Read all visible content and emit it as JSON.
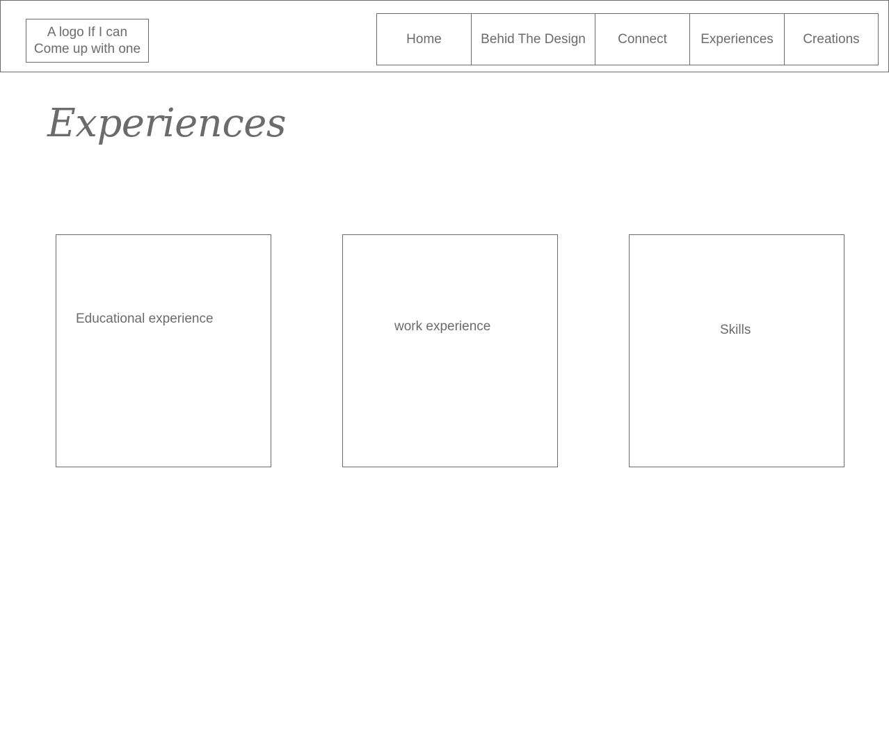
{
  "header": {
    "logo_text": "A logo If I can Come up with one",
    "nav": [
      {
        "label": "Home"
      },
      {
        "label": "Behid The Design"
      },
      {
        "label": "Connect"
      },
      {
        "label": "Experiences"
      },
      {
        "label": "Creations"
      }
    ]
  },
  "main": {
    "title": "Experiences",
    "cards": [
      {
        "label": "Educational experience"
      },
      {
        "label": "work experience"
      },
      {
        "label": "Skills"
      }
    ]
  },
  "colors": {
    "text": "#6b6b6b",
    "border": "#6b6b6b",
    "background": "#ffffff"
  }
}
